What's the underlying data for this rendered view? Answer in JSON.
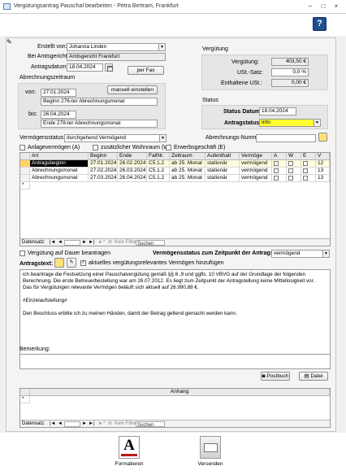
{
  "window": {
    "title": "Vergütungsantrag Pauschal bearbeiten - Petra Bertram, Frankfurt",
    "help": "?",
    "min": "–",
    "max": "□",
    "close": "×"
  },
  "form": {
    "erstellt_von_label": "Erstellt von:",
    "erstellt_von": "Johanna Linden",
    "amtsgericht_label": "Bei Amtsgericht:",
    "amtsgericht": "Amtsgericht Frankfurt",
    "antragsdatum_label": "Antragsdatum:",
    "antragsdatum": "18.04.2024",
    "per_fax": "per Fax",
    "abrechnungszeitraum_label": "Abrechnungszeitraum",
    "von_label": "von:",
    "von": "27.01.2024",
    "manuell_button": "manuell einstellen",
    "von_text": "Beginn 276-ter Abrechnungsmonat",
    "bis_label": "bis:",
    "bis": "26.04.2024",
    "bis_text": "Ende 278-ter Abrechnungsmonat",
    "vermoegensstatus_label": "Vermögensstatus:",
    "vermoegensstatus": "durchgehend Vermögend",
    "abrechnungs_nummer_label": "Abrechnungs-Nummer:",
    "abrechnungs_nummer": "",
    "cb_anlage": "Anlagevermögen (A)",
    "cb_wohnraum": "zusätzlicher Wohnraum (W)",
    "cb_erwerb": "Erwerbsgeschäft (E)"
  },
  "verguetung": {
    "section": "Vergütung",
    "verguetung_label": "Vergütung:",
    "verguetung": "403,50 €",
    "ust_satz_label": "USt.-Satz:",
    "ust_satz": "0,0 %",
    "ust_label": "Enthaltene USt.:",
    "ust": "0,00 €"
  },
  "status": {
    "section": "Status",
    "datum_label": "Status Datum:",
    "datum": "18.04.2024",
    "antrag_label": "Antragstatus:",
    "antrag": "Info"
  },
  "table": {
    "headers": [
      "Art",
      "Beginn",
      "Ende",
      "FallNr.",
      "Zeitraum",
      "Aufenthalt",
      "Vermöge",
      "A",
      "W",
      "E",
      "V"
    ],
    "rows": [
      [
        "Antragsbeginn",
        "27.01.2024",
        "26.02.2024",
        "C5.1.2",
        "ab 25. Monat",
        "stationär",
        "vermögend",
        "",
        "",
        "",
        "12"
      ],
      [
        "Abrechnungsmonat",
        "27.02.2024",
        "26.03.2024",
        "C5.1.2",
        "ab 25. Monat",
        "stationär",
        "vermögend",
        "",
        "",
        "",
        "13"
      ],
      [
        "Abrechnungsmonat",
        "27.03.2024",
        "26.04.2024",
        "C5.1.2",
        "ab 25. Monat",
        "stationär",
        "vermögend",
        "",
        "",
        "",
        "13"
      ]
    ],
    "nav": {
      "datensatz": "Datensatz:",
      "kein_filter": "Kein Filter",
      "suchen": "Suchen"
    }
  },
  "lower": {
    "dauer_label": "Vergütung auf Dauer beantragen",
    "vstatus_label": "Vermögensstatus zum Zeitpunkt der Antragstellung:",
    "vstatus": "vermögend",
    "antragstext_label": "Antragstext:",
    "aktuelles_label": "aktuelles vergütungsrelevantes Vermögen hinzufügen",
    "text_lines": [
      "ich beantrage die Festsetzung einer Pauschalvergütung gemäß §§ 8 ,9 und ggfls. 10 VBVG auf der Grundlage der folgenden",
      "Berechnung. Die erste Betreuerbestellung war am 26.07.2012. Es liegt zum Zeitpunkt der Antragstellung keine Mittellosigkeit vor.",
      "Das für Vergütungen relevante Vermögen beläuft sich aktuell auf 26.990,88 €.",
      "",
      "#Einzelaufstellung#",
      "",
      "Den Beschluss erbitte ich zu meinen Händen, damit der Betrag geltend gemacht werden kann."
    ],
    "bemerkung_label": "Bemerkung:",
    "postbuch": "Postbuch",
    "datei": "Datei",
    "anhang_header": "Anhang"
  },
  "bottom": {
    "formatieren": "Formatieren",
    "versenden": "Versenden"
  },
  "colors": {
    "accent": "#ffff33",
    "title_blue": "#1e4f8f",
    "group_bg": "#e6e6e6"
  }
}
